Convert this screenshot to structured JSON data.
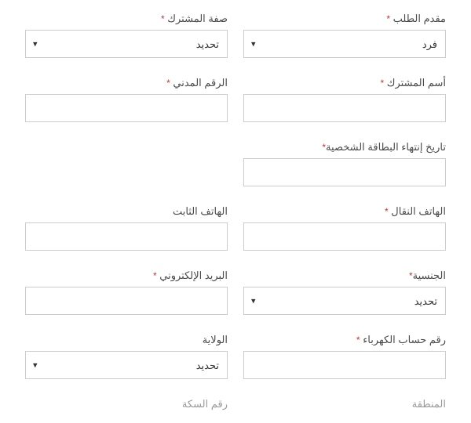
{
  "fields": {
    "applicant_type": {
      "label": "مقدم الطلب",
      "value": "فرد",
      "required": true
    },
    "subscriber_capacity": {
      "label": "صفة المشترك",
      "value": "تحديد",
      "required": true
    },
    "subscriber_name": {
      "label": "أسم المشترك",
      "value": "",
      "required": true
    },
    "civil_number": {
      "label": "الرقم المدني",
      "value": "",
      "required": true
    },
    "id_expiry": {
      "label": "تاريخ إنتهاء البطاقة الشخصية",
      "value": "",
      "required": true
    },
    "mobile": {
      "label": "الهاتف النقال",
      "value": "",
      "required": true
    },
    "landline": {
      "label": "الهاتف الثابت",
      "value": "",
      "required": false
    },
    "nationality": {
      "label": "الجنسية",
      "value": "تحديد",
      "required": true
    },
    "email": {
      "label": "البريد الإلكتروني",
      "value": "",
      "required": true
    },
    "electricity_account": {
      "label": "رقم حساب الكهرباء",
      "value": "",
      "required": true
    },
    "wilayat": {
      "label": "الولاية",
      "value": "تحديد",
      "required": false
    },
    "area": {
      "label": "المنطقة",
      "value": "",
      "required": false
    },
    "block_number": {
      "label": "رقم السكة",
      "value": "",
      "required": false
    }
  },
  "required_mark": "*"
}
